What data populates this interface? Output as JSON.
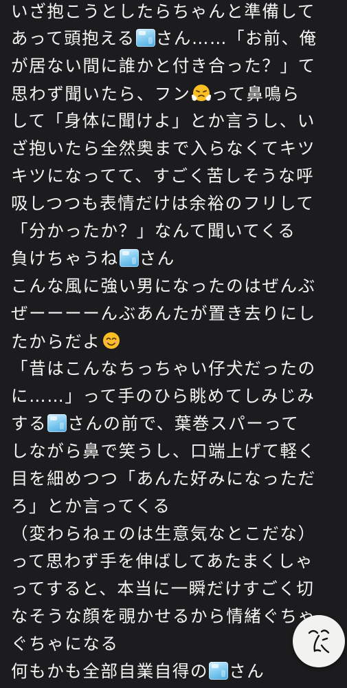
{
  "lines": [
    "いざ抱こうとしたらちゃんと準備して",
    "あって頭抱える",
    "さん……「お前、俺",
    "が居ない間に誰かと付き合った？」て",
    "思わず聞いたら、フン",
    "って鼻鳴ら",
    "して「身体に聞けよ」とか言うし、い",
    "ざ抱いたら全然奥まで入らなくてキツ",
    "キツになってて、すごく苦しそうな呼",
    "吸しつつも表情だけは余裕のフリして",
    "「分かったか？」なんて聞いてくる",
    "負けちゃうね",
    "さん",
    "こんな風に強い男になったのはぜんぶ",
    "ぜーーーーんぶあんたが置き去りにし",
    "たからだよ",
    "「昔はこんなちっちゃい仔犬だったの",
    "に……」って手のひら眺めてしみじみ",
    "する",
    "さんの前で、葉巻スパーって",
    "しながら鼻で笑うし、口端上げて軽く",
    "目を細めつつ「あんた好みになっただ",
    "ろ」とか言ってくる",
    "（変わらねェのは生意気なとこだな）",
    "って思わず手を伸ばしてあたまくしゃ",
    "ってすると、本当に一瞬だけすごく切",
    "なそうな顔を覗かせるから情緒ぐちゃ",
    "ぐちゃになる",
    "何もかも全部自業自得の",
    "さん"
  ],
  "icons": {
    "ice": "ice-cube-emoji",
    "huff": "face-with-steam-from-nose-emoji",
    "smile": "smiling-face-with-smiling-eyes-emoji",
    "fab": "handwritten-face-icon"
  },
  "colors": {
    "background": "#1c1c1e",
    "text": "#f4f4f4",
    "fab": "#f2f2f0"
  }
}
